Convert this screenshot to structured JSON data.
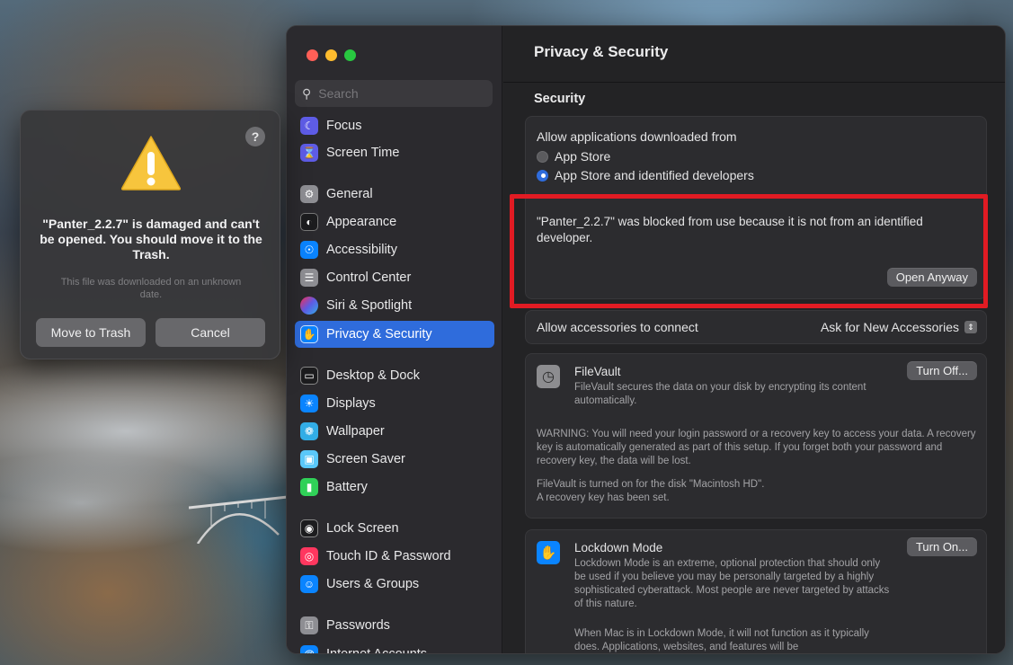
{
  "sidebar": {
    "search_placeholder": "Search",
    "items": [
      {
        "label": "Focus",
        "icon": "moon-icon",
        "color": "#5e5ce6"
      },
      {
        "label": "Screen Time",
        "icon": "hourglass-icon",
        "color": "#5e5ce6"
      },
      {
        "label": "General",
        "icon": "gear-icon",
        "color": "#8e8e93"
      },
      {
        "label": "Appearance",
        "icon": "appearance-icon",
        "color": "#1c1c1e"
      },
      {
        "label": "Accessibility",
        "icon": "accessibility-icon",
        "color": "#0a84ff"
      },
      {
        "label": "Control Center",
        "icon": "control-center-icon",
        "color": "#8e8e93"
      },
      {
        "label": "Siri & Spotlight",
        "icon": "siri-icon",
        "color": "#bf5af2"
      },
      {
        "label": "Privacy & Security",
        "icon": "hand-icon",
        "color": "#0a84ff"
      },
      {
        "label": "Desktop & Dock",
        "icon": "dock-icon",
        "color": "#1c1c1e"
      },
      {
        "label": "Displays",
        "icon": "sun-icon",
        "color": "#0a84ff"
      },
      {
        "label": "Wallpaper",
        "icon": "flower-icon",
        "color": "#32ade6"
      },
      {
        "label": "Screen Saver",
        "icon": "screensaver-icon",
        "color": "#5ac8fa"
      },
      {
        "label": "Battery",
        "icon": "battery-icon",
        "color": "#30d158"
      },
      {
        "label": "Lock Screen",
        "icon": "lock-icon",
        "color": "#1c1c1e"
      },
      {
        "label": "Touch ID & Password",
        "icon": "fingerprint-icon",
        "color": "#ff375f"
      },
      {
        "label": "Users & Groups",
        "icon": "users-icon",
        "color": "#0a84ff"
      },
      {
        "label": "Passwords",
        "icon": "key-icon",
        "color": "#8e8e93"
      },
      {
        "label": "Internet Accounts",
        "icon": "at-icon",
        "color": "#0a84ff"
      }
    ]
  },
  "main": {
    "title": "Privacy & Security",
    "security_heading": "Security",
    "allow_label": "Allow applications downloaded from",
    "option_app_store": "App Store",
    "option_identified": "App Store and identified developers",
    "blocked_message": "\"Panter_2.2.7\" was blocked from use because it is not from an identified developer.",
    "open_anyway": "Open Anyway",
    "accessories_label": "Allow accessories to connect",
    "accessories_value": "Ask for New Accessories",
    "filevault": {
      "title": "FileVault",
      "desc": "FileVault secures the data on your disk by encrypting its content automatically.",
      "button": "Turn Off...",
      "warning": "WARNING: You will need your login password or a recovery key to access your data. A recovery key is automatically generated as part of this setup. If you forget both your password and recovery key, the data will be lost.",
      "status_line1": "FileVault is turned on for the disk \"Macintosh HD\".",
      "status_line2": "A recovery key has been set."
    },
    "lockdown": {
      "title": "Lockdown Mode",
      "desc": "Lockdown Mode is an extreme, optional protection that should only be used if you believe you may be personally targeted by a highly sophisticated cyberattack. Most people are never targeted by attacks of this nature.",
      "button": "Turn On...",
      "desc2": "When Mac is in Lockdown Mode, it will not function as it typically does. Applications, websites, and features will be"
    }
  },
  "alert": {
    "help": "?",
    "title": "\"Panter_2.2.7\" is damaged and can't be opened. You should move it to the Trash.",
    "subtitle": "This file was downloaded on an unknown date.",
    "move_to_trash": "Move to Trash",
    "cancel": "Cancel"
  }
}
